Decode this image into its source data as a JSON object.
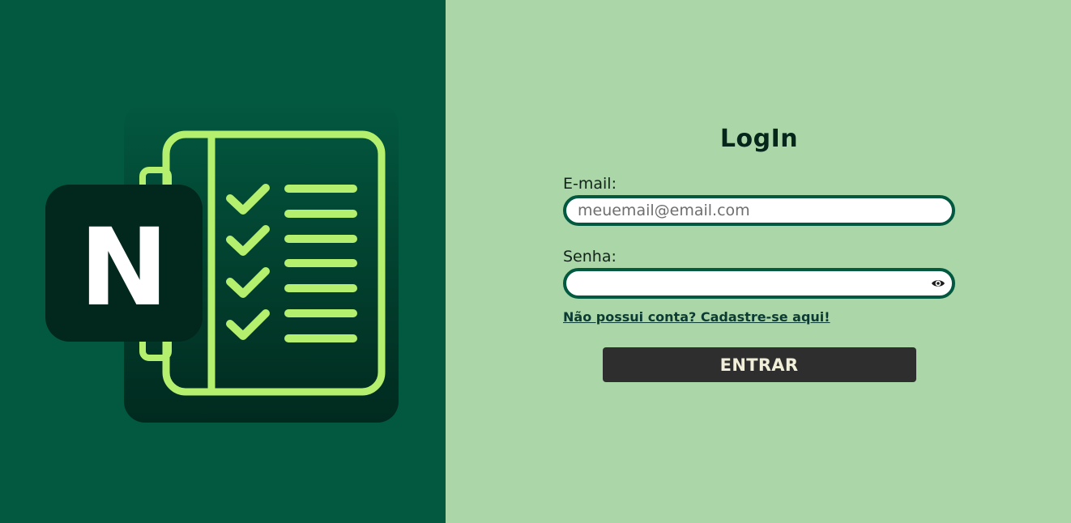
{
  "login": {
    "title": "LogIn",
    "email_label": "E-mail:",
    "email_placeholder": "meuemail@email.com",
    "email_value": "",
    "password_label": "Senha:",
    "password_value": "",
    "signup_link": "Não possui conta? Cadastre-se aqui!",
    "submit_label": "ENTRAR"
  },
  "logo": {
    "letter": "N"
  },
  "icons": {
    "password_toggle": "eye-icon"
  },
  "colors": {
    "left_panel": "#025940",
    "right_panel": "#abd6a7",
    "input_border": "#025940",
    "button_bg": "#2e2e2e",
    "button_text": "#f1efd9",
    "logo_accent": "#b4f06e",
    "logo_tile": "#02271c"
  }
}
